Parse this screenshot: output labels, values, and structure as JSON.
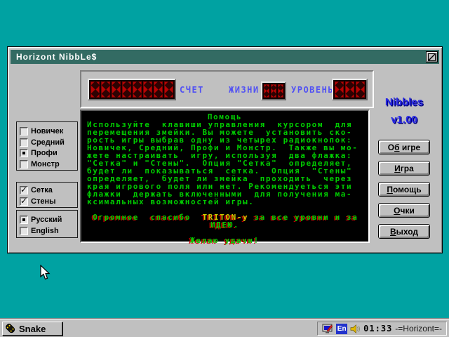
{
  "colors": {
    "desktop": "#00a2a2",
    "titlebar": "#336b63",
    "chrome": "#c0c0c0",
    "led_red": "#b80404",
    "screen_green": "#00cc00",
    "screen_yellow": "#cccc00",
    "screen_shadow_red": "#c80000",
    "scoreboard_label_blue": "#5151f3",
    "logo_blue": "#2929e6",
    "logo_shadow_navy": "#000080",
    "tray_en_bg": "#2233cc"
  },
  "window": {
    "title": "Horizont NibbLe$",
    "titlebar_icon": "diagonal-slash-icon",
    "scoreboard": {
      "score_label": "СЧЕТ",
      "lives_label": "ЖИЗНИ",
      "level_label": "УРОВЕНЬ",
      "score_digit_cells": 8,
      "lives_digit_cells": 3,
      "level_digit_cells": 3
    },
    "screen": {
      "lines": [
        {
          "align": "center",
          "segs": [
            {
              "t": "Помощь",
              "c": "g"
            }
          ]
        },
        {
          "segs": [
            {
              "t": "Используйте  клавиши управления  курсором  для",
              "c": "g"
            }
          ]
        },
        {
          "segs": [
            {
              "t": "перемещения змейки. Вы можете  установить ско-",
              "c": "g"
            }
          ]
        },
        {
          "segs": [
            {
              "t": "рость игры выбрав одну из четырех радиокнопок:",
              "c": "g"
            }
          ]
        },
        {
          "segs": [
            {
              "t": "Новичек, Средний, Профи и Монстр.  Также вы мо-",
              "c": "g"
            }
          ]
        },
        {
          "segs": [
            {
              "t": "жете настраивать  игру, используя  два флажка:",
              "c": "g"
            }
          ]
        },
        {
          "segs": [
            {
              "t": "\"Сетка\" и \"Стены\".  Опция \"Сетка\"  определяет,",
              "c": "g"
            }
          ]
        },
        {
          "segs": [
            {
              "t": "будет ли  показываться  сетка.  Опция  \"Стены\"",
              "c": "g"
            }
          ]
        },
        {
          "segs": [
            {
              "t": "определяет,  будет ли змейка  проходить  через",
              "c": "g"
            }
          ]
        },
        {
          "segs": [
            {
              "t": "края игрового поля или нет. Рекомендуеться эти",
              "c": "g"
            }
          ]
        },
        {
          "segs": [
            {
              "t": "флажки  держать включенными  для получения ма-",
              "c": "g"
            }
          ]
        },
        {
          "segs": [
            {
              "t": "ксимальных возможностей игры.",
              "c": "g"
            }
          ]
        },
        {
          "segs": [
            {
              "t": "",
              "c": "g"
            }
          ]
        },
        {
          "segs": [
            {
              "t": " Огромное  спасибо  ",
              "c": "gs"
            },
            {
              "t": "TRITON-у",
              "c": "ys"
            },
            {
              "t": " за все уровни и за",
              "c": "gs"
            }
          ]
        },
        {
          "align": "center",
          "segs": [
            {
              "t": "ИДЕЮ.",
              "c": "gs"
            }
          ]
        },
        {
          "segs": [
            {
              "t": "",
              "c": "g"
            }
          ]
        },
        {
          "align": "center",
          "segs": [
            {
              "t": "Желаю удачи!",
              "c": "gs"
            }
          ]
        }
      ]
    },
    "difficulty": {
      "items": [
        {
          "name": "difficulty-novice",
          "label": "Новичек",
          "selected": false
        },
        {
          "name": "difficulty-medium",
          "label": "Средний",
          "selected": false
        },
        {
          "name": "difficulty-pro",
          "label": "Профи",
          "selected": true
        },
        {
          "name": "difficulty-monster",
          "label": "Монстр",
          "selected": false
        }
      ]
    },
    "options": {
      "items": [
        {
          "name": "option-grid",
          "label": "Сетка",
          "checked": true
        },
        {
          "name": "option-walls",
          "label": "Стены",
          "checked": true
        }
      ]
    },
    "language": {
      "items": [
        {
          "name": "language-russian",
          "label": "Русский",
          "selected": true
        },
        {
          "name": "language-english",
          "label": "English",
          "selected": false
        }
      ]
    },
    "logo": {
      "line1": "Nibbles",
      "line2": "v1.00"
    },
    "buttons": [
      {
        "name": "about-game-button",
        "pre": "О",
        "key": "б",
        "post": " игре"
      },
      {
        "name": "game-button",
        "pre": "",
        "key": "И",
        "post": "гра"
      },
      {
        "name": "help-button",
        "pre": "",
        "key": "П",
        "post": "омощь"
      },
      {
        "name": "scores-button",
        "pre": "",
        "key": "О",
        "post": "чки"
      },
      {
        "name": "exit-button",
        "pre": "",
        "key": "В",
        "post": "ыход"
      }
    ]
  },
  "taskbar": {
    "task_button": {
      "label": "Snake",
      "icon": "snake-icon"
    },
    "tray": {
      "icons": [
        "display-icon",
        "volume-icon"
      ],
      "lang_indicator": "En",
      "time": "01:33",
      "status": "-=Horizont=-"
    }
  },
  "cursor": {
    "icon": "arrow-pointer"
  }
}
